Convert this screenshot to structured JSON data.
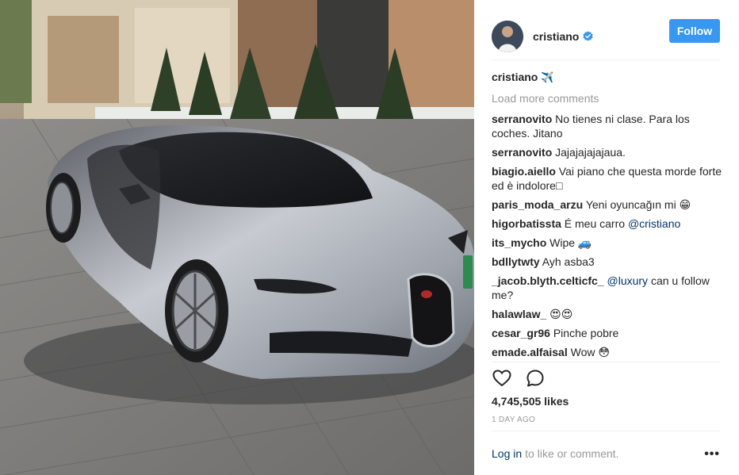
{
  "post": {
    "photo_icon": "car-photo",
    "author": {
      "username": "cristiano",
      "verified_icon": "verified-badge-icon"
    },
    "follow_label": "Follow",
    "caption": {
      "username": "cristiano",
      "emoji": "✈️"
    },
    "load_more": "Load more comments",
    "comments": [
      {
        "user": "serranovito",
        "text": "No tienes ni clase. Para los coches. Jitano"
      },
      {
        "user": "serranovito",
        "text": "Jajajajajajaua."
      },
      {
        "user": "biagio.aiello",
        "text": "Vai piano che questa morde forte ed è indolore□"
      },
      {
        "user": "paris_moda_arzu",
        "text": "Yeni oyuncağın mi 😁"
      },
      {
        "user": "higorbatissta",
        "text": "É meu carro ",
        "mention": "@cristiano"
      },
      {
        "user": "its_mycho",
        "text": "Wipe 🚙"
      },
      {
        "user": "bdllytwty",
        "text": "Ayh asba3"
      },
      {
        "user": "_jacob.blyth.celticfc_",
        "mention_first": "@luxury",
        "text": " can u follow me?"
      },
      {
        "user": "halawlaw_",
        "text": "😍😍"
      },
      {
        "user": "cesar_gr96",
        "text": "Pinche pobre"
      },
      {
        "user": "emade.alfaisal",
        "text": "Wow 😳"
      }
    ],
    "likes": "4,745,505 likes",
    "time": "1 DAY AGO",
    "footer": {
      "login": "Log in",
      "rest": "to like or comment.",
      "more": "•••"
    },
    "colors": {
      "accent": "#3897f0",
      "link": "#003569",
      "muted": "#999999",
      "text": "#262626"
    }
  }
}
